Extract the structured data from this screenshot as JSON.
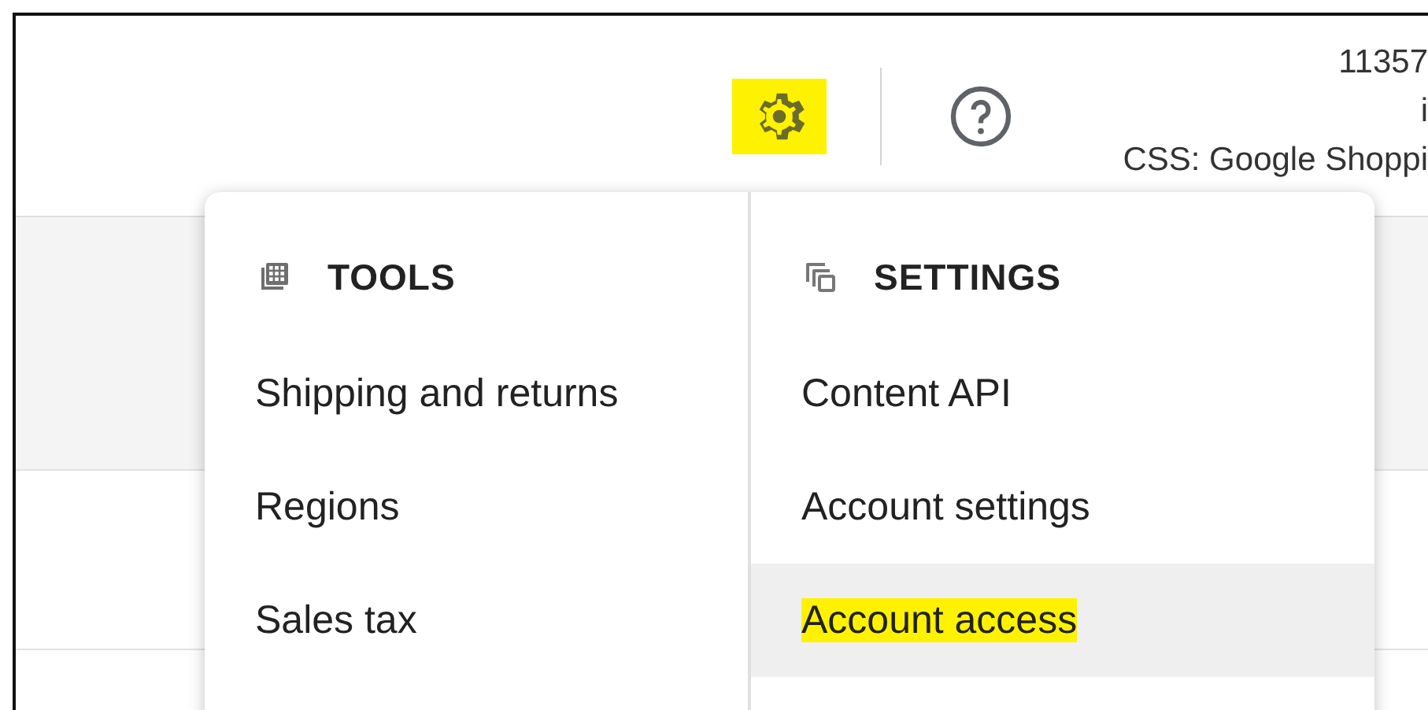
{
  "header": {
    "settings_button": {
      "highlighted": true
    },
    "account": {
      "lines": [
        "11357",
        "i",
        "CSS: Google Shoppi"
      ]
    }
  },
  "menu": {
    "sections": [
      {
        "kind": "tools",
        "title": "TOOLS",
        "items": [
          {
            "label": "Shipping and returns",
            "selected": false,
            "highlighted": false
          },
          {
            "label": "Regions",
            "selected": false,
            "highlighted": false
          },
          {
            "label": "Sales tax",
            "selected": false,
            "highlighted": false
          }
        ]
      },
      {
        "kind": "settings",
        "title": "SETTINGS",
        "items": [
          {
            "label": "Content API",
            "selected": false,
            "highlighted": false
          },
          {
            "label": "Account settings",
            "selected": false,
            "highlighted": false
          },
          {
            "label": "Account access",
            "selected": true,
            "highlighted": true
          }
        ]
      }
    ]
  }
}
